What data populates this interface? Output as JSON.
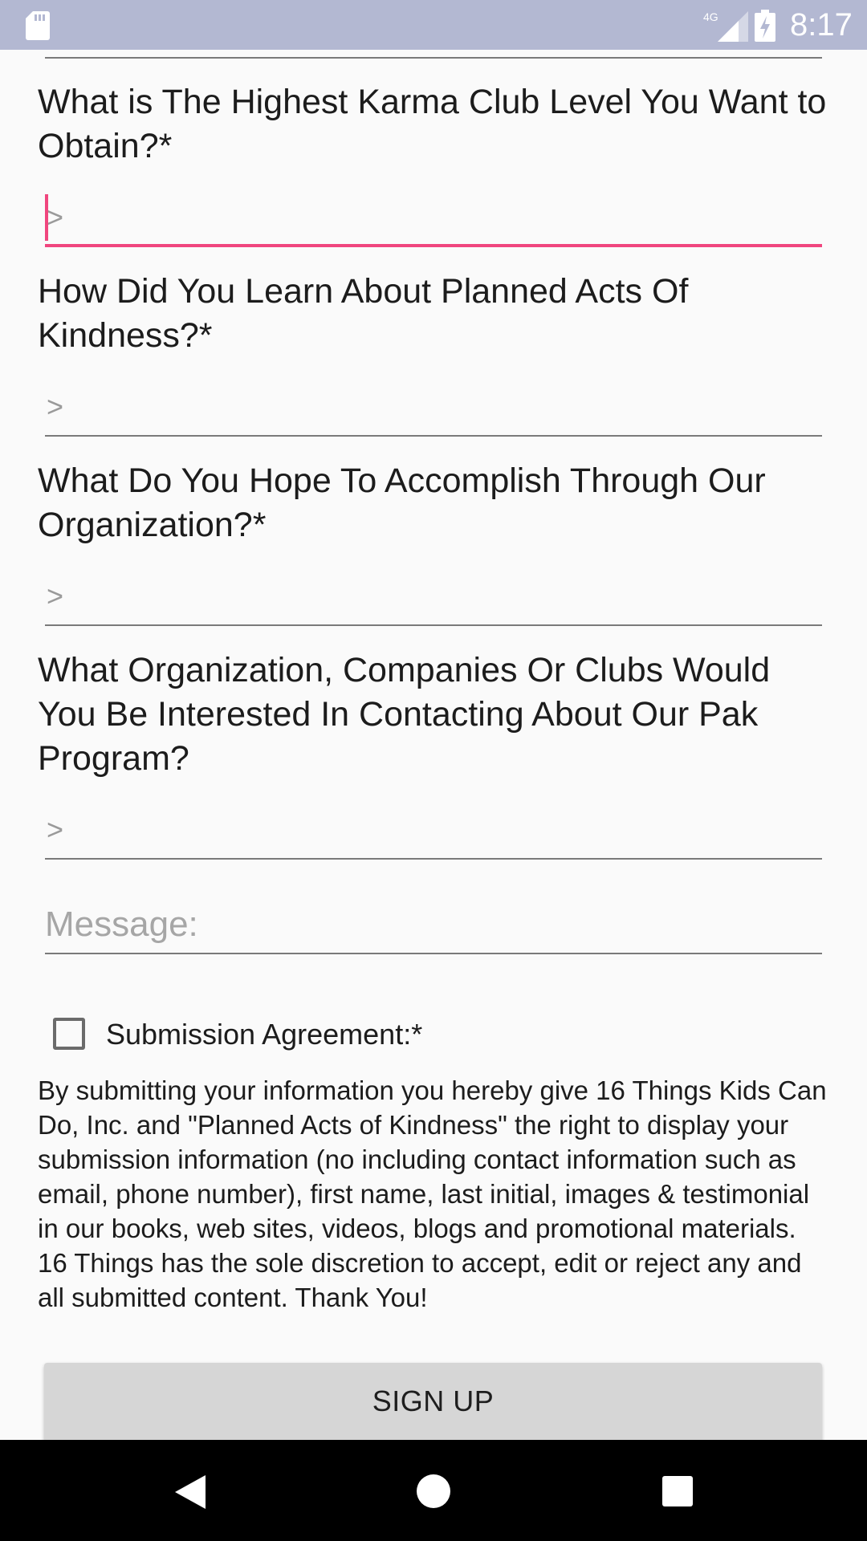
{
  "status_bar": {
    "time": "8:17",
    "network": "4G",
    "icons": [
      "sd-card-icon",
      "cell-signal-icon",
      "battery-charging-icon"
    ]
  },
  "form": {
    "questions": [
      {
        "label": "What is The Highest Karma Club Level You Want to Obtain?*",
        "value": ">",
        "focused": true
      },
      {
        "label": "How Did You Learn About Planned Acts Of Kindness?*",
        "value": ">"
      },
      {
        "label": "What Do You Hope To Accomplish Through Our Organization?*",
        "value": ">"
      },
      {
        "label": "What Organization, Companies Or Clubs Would You Be Interested In Contacting About Our Pak Program?",
        "value": ">"
      }
    ],
    "message": {
      "placeholder": "Message:",
      "value": ""
    },
    "agreement": {
      "label": "Submission Agreement:*",
      "checked": false,
      "text": "By submitting your information you hereby give 16 Things Kids Can Do, Inc. and \"Planned Acts of Kindness\" the right to display your submission information (no including contact information such as email, phone number), first name, last initial, images & testimonial in our books, web sites, videos, blogs and promotional materials. 16 Things has the sole discretion to accept, edit or reject any and all submitted content. Thank You!"
    },
    "signup_label": "SIGN UP"
  },
  "nav_bar": {
    "icons": [
      "back-icon",
      "home-icon",
      "recents-icon"
    ]
  },
  "colors": {
    "status_bar": "#b3b8d2",
    "accent": "#f0467e",
    "background": "#fafafa",
    "button": "#d6d6d6",
    "nav_bar": "#000000"
  }
}
